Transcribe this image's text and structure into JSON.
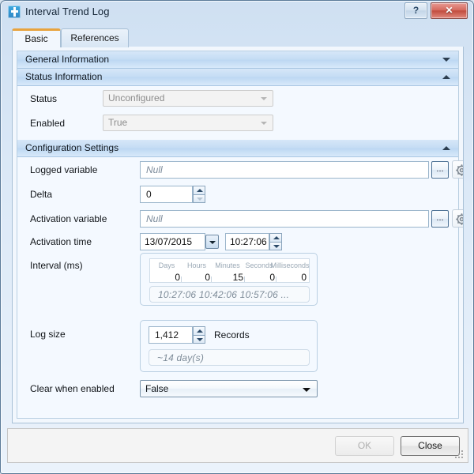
{
  "window": {
    "title": "Interval Trend Log",
    "icon": "trend-log-icon",
    "help_label": "?",
    "close_label": "✕"
  },
  "tabs": [
    {
      "label": "Basic",
      "active": true
    },
    {
      "label": "References",
      "active": false
    }
  ],
  "sections": {
    "general": {
      "title": "General Information",
      "expanded": false,
      "chevron": "chevron-down-icon"
    },
    "status": {
      "title": "Status Information",
      "expanded": true,
      "chevron": "chevron-up-icon"
    },
    "config": {
      "title": "Configuration Settings",
      "expanded": true,
      "chevron": "chevron-up-icon"
    }
  },
  "status_information": {
    "status": {
      "label": "Status",
      "value": "Unconfigured",
      "disabled": true
    },
    "enabled": {
      "label": "Enabled",
      "value": "True",
      "disabled": true
    }
  },
  "configuration": {
    "logged_variable": {
      "label": "Logged variable",
      "value": "Null",
      "browse_label": "...",
      "settings_icon": "gear-icon"
    },
    "delta": {
      "label": "Delta",
      "value": "0"
    },
    "activation_variable": {
      "label": "Activation variable",
      "value": "Null",
      "browse_label": "...",
      "settings_icon": "gear-icon"
    },
    "activation_time": {
      "label": "Activation time",
      "date": "13/07/2015",
      "time": "10:27:06"
    },
    "interval": {
      "label": "Interval (ms)",
      "columns": [
        "Days",
        "Hours",
        "Minutes",
        "Seconds",
        "Milliseconds"
      ],
      "values": [
        "0",
        "0",
        "15",
        "0",
        "0"
      ],
      "preview": "10:27:06  10:42:06  10:57:06 ..."
    },
    "log_size": {
      "label": "Log size",
      "value": "1,412",
      "units": "Records",
      "estimate": "~14 day(s)"
    },
    "clear_when_enabled": {
      "label": "Clear when enabled",
      "value": "False"
    }
  },
  "footer": {
    "ok_label": "OK",
    "close_label": "Close"
  }
}
